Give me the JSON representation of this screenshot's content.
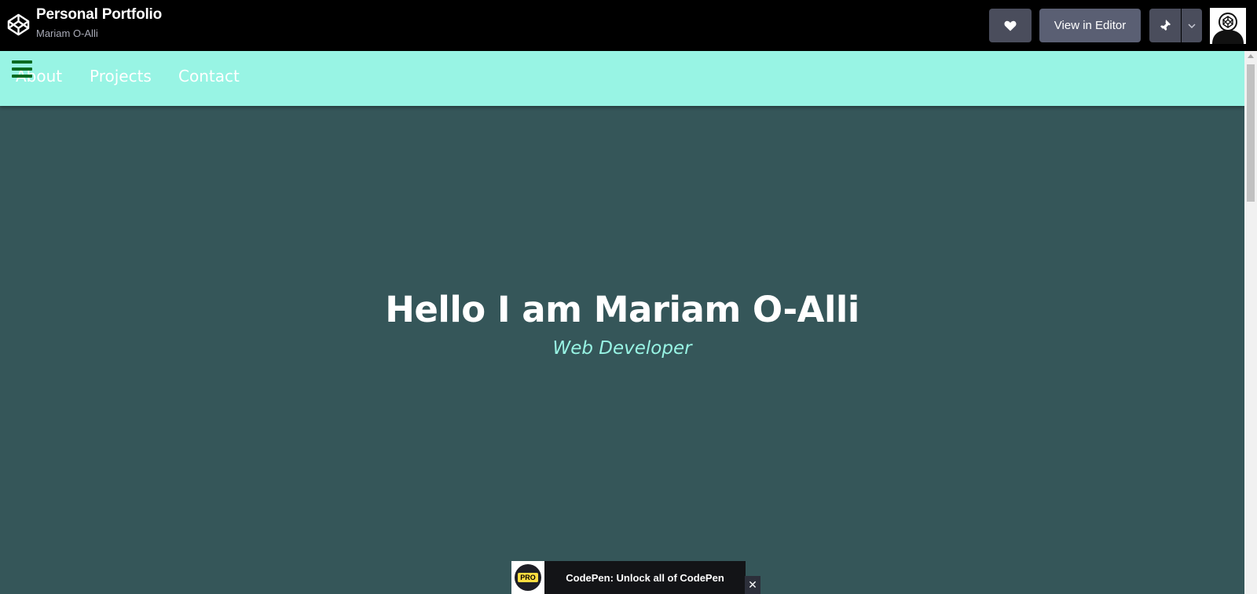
{
  "codepen": {
    "pen_title": "Personal Portfolio",
    "author": "Mariam O-Alli",
    "view_in_editor_label": "View in Editor"
  },
  "preview": {
    "nav_links": [
      "About",
      "Projects",
      "Contact"
    ],
    "hero_title": "Hello I am Mariam O-Alli",
    "hero_subtitle": "Web Developer"
  },
  "toast": {
    "badge": "PRO",
    "text": "CodePen: Unlock all of CodePen",
    "close_symbol": "✕"
  },
  "colors": {
    "navbar_bg": "#98f4e4",
    "page_bg": "#355659",
    "hamburger": "#0a6b22",
    "subtitle": "#98f4e4"
  },
  "icons": [
    "codepen-logo-icon",
    "heart-icon",
    "pin-icon",
    "chevron-down-icon",
    "hamburger-menu-icon",
    "close-icon"
  ]
}
